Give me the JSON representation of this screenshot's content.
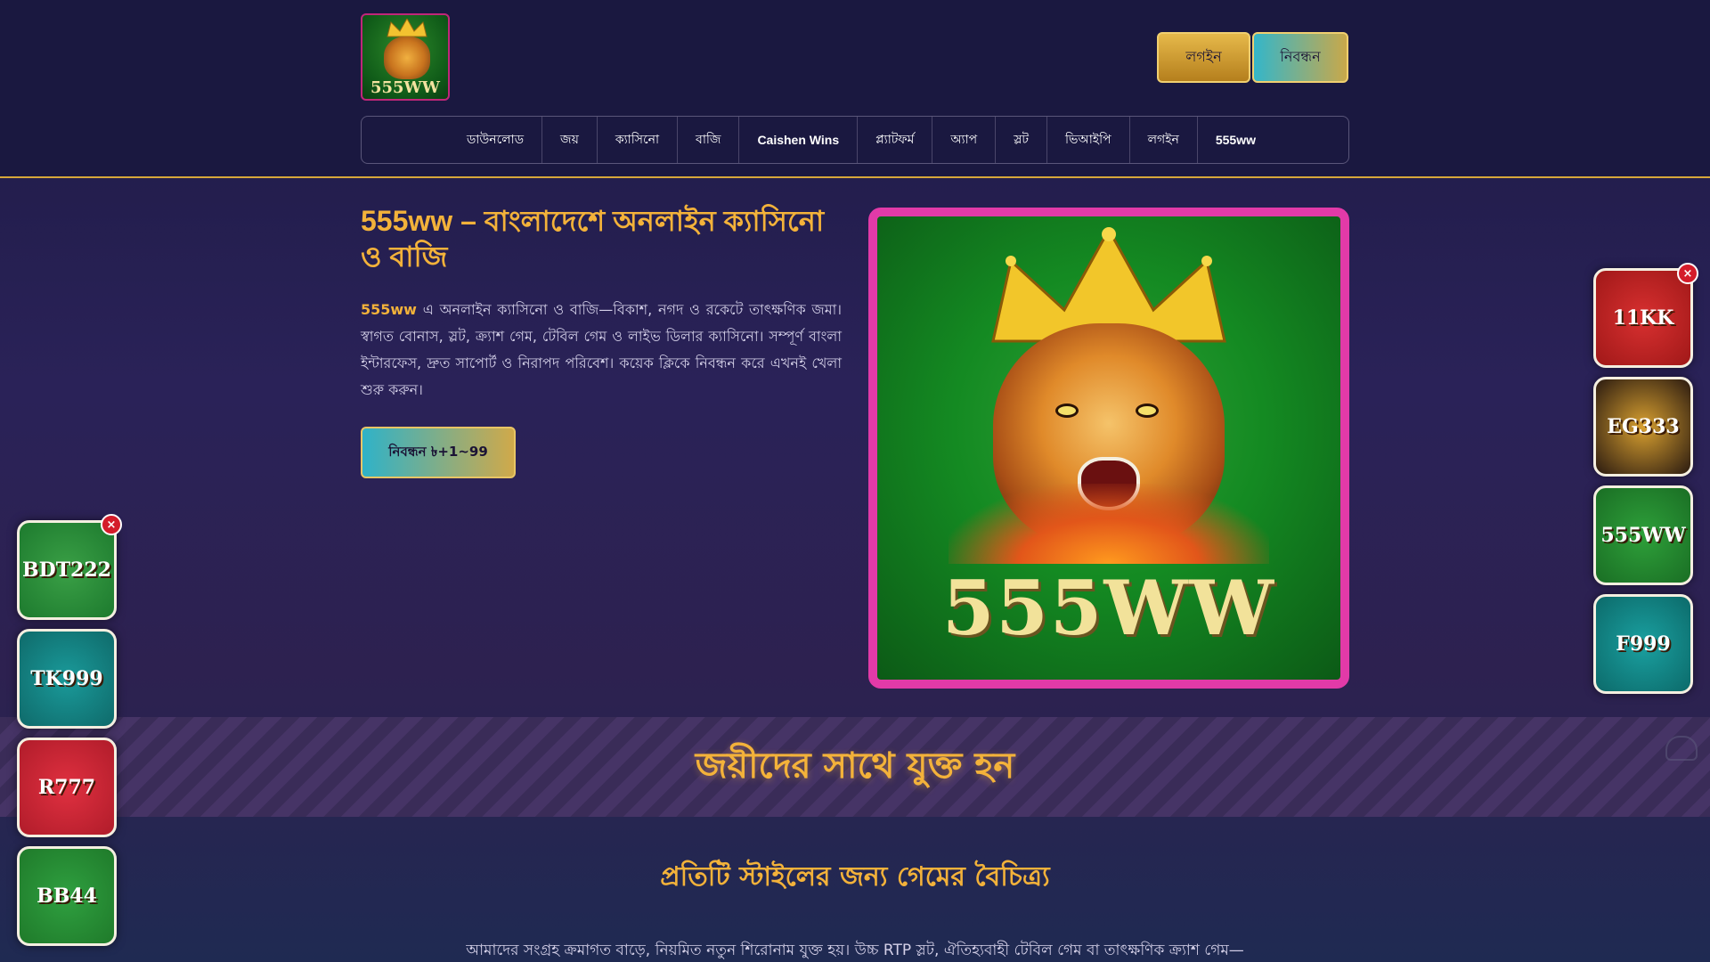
{
  "header": {
    "logo_text": "555WW",
    "login_label": "লগইন",
    "register_label": "নিবন্ধন"
  },
  "nav": {
    "items": [
      "ডাউনলোড",
      "জয়",
      "ক্যাসিনো",
      "বাজি",
      "Caishen Wins",
      "প্ল্যাটফর্ম",
      "অ্যাপ",
      "স্লট",
      "ভিআইপি",
      "লগইন",
      "555ww"
    ]
  },
  "hero": {
    "title": "555ww – বাংলাদেশে অনলাইন ক্যাসিনো ও বাজি",
    "brand": "555ww",
    "text": " এ অনলাইন ক্যাসিনো ও বাজি—বিকাশ, নগদ ও রকেটে তাৎক্ষণিক জমা। স্বাগত বোনাস, স্লট, ক্র্যাশ গেম, টেবিল গেম ও লাইভ ডিলার ক্যাসিনো। সম্পূর্ণ বাংলা ইন্টারফেস, দ্রুত সাপোর্ট ও নিরাপদ পরিবেশ। কয়েক ক্লিকে নিবন্ধন করে এখনই খেলা শুরু করুন।",
    "cta_label": "নিবন্ধন ৳+1~99",
    "image_text": "555WW"
  },
  "band": {
    "title": "জয়ীদের সাথে যুক্ত হন"
  },
  "section": {
    "title": "প্রতিটি স্টাইলের জন্য গেমের বৈচিত্র্য",
    "text": "আমাদের সংগ্রহ ক্রমাগত বাড়ে, নিয়মিত নতুন শিরোনাম যুক্ত হয়। উচ্চ RTP স্লট, ঐতিহ্যবাহী টেবিল গেম বা তাৎক্ষণিক ক্র্যাশ গেম—"
  },
  "left_apps": {
    "close": "×",
    "items": [
      {
        "label": "BDT222",
        "color": "#1d7a2e"
      },
      {
        "label": "TK999",
        "color": "#0f6a6a"
      },
      {
        "label": "R777",
        "color": "#b01c2a"
      },
      {
        "label": "BB44",
        "color": "#1f7a2a"
      }
    ]
  },
  "right_apps": {
    "close": "×",
    "items": [
      {
        "label": "11KK",
        "color": "#a01818"
      },
      {
        "label": "EG333",
        "color": "#2a1a10"
      },
      {
        "label": "555WW",
        "color": "#1a6e24"
      },
      {
        "label": "F999",
        "color": "#0c6a6a"
      }
    ]
  }
}
